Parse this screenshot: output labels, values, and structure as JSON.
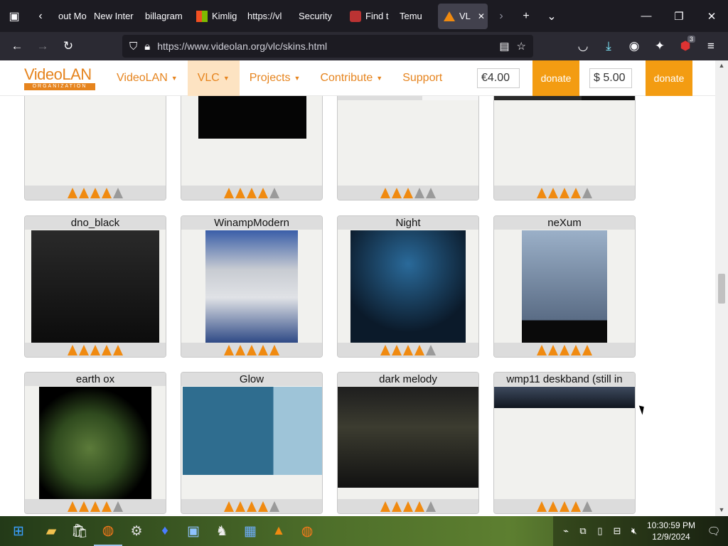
{
  "tabs": [
    {
      "label": "out Mo",
      "icon": "page-icon"
    },
    {
      "label": "New Inter",
      "icon": "page-icon"
    },
    {
      "label": "billagram",
      "icon": "page-icon"
    },
    {
      "label": "Kimlig",
      "icon": "windows-logo-icon"
    },
    {
      "label": "https://vl",
      "icon": "page-icon"
    },
    {
      "label": "Security",
      "icon": "page-icon"
    },
    {
      "label": "Find t",
      "icon": "shield-icon"
    },
    {
      "label": "Temu",
      "icon": "page-icon"
    },
    {
      "label": "VL",
      "icon": "vlc-cone-icon",
      "active": true
    }
  ],
  "address": {
    "url": "https://www.videolan.org/vlc/skins.html"
  },
  "extensions_badge": "3",
  "site": {
    "logo_main": "VideoLAN",
    "logo_sub": "ORGANIZATION",
    "menu": [
      {
        "label": "VideoLAN",
        "dropdown": true
      },
      {
        "label": "VLC",
        "dropdown": true,
        "active": true
      },
      {
        "label": "Projects",
        "dropdown": true
      },
      {
        "label": "Contribute",
        "dropdown": true
      },
      {
        "label": "Support",
        "dropdown": false
      }
    ],
    "donate_eur_value": "€4.00",
    "donate_usd_value": "$ 5.00",
    "donate_label": "donate",
    "accent": "#e6841e",
    "donate_color": "#f39c12"
  },
  "skins": [
    {
      "title": "",
      "rating": 4
    },
    {
      "title": "",
      "rating": 4
    },
    {
      "title": "",
      "rating": 3
    },
    {
      "title": "",
      "rating": 4
    },
    {
      "title": "dno_black",
      "rating": 5
    },
    {
      "title": "WinampModern",
      "rating": 5
    },
    {
      "title": "Night",
      "rating": 4
    },
    {
      "title": "neXum",
      "rating": 5
    },
    {
      "title": "earth ox",
      "rating": 4
    },
    {
      "title": "Glow",
      "rating": 4
    },
    {
      "title": "dark melody",
      "rating": 4
    },
    {
      "title": "wmp11 deskband (still in",
      "rating": 4
    }
  ],
  "taskbar": {
    "apps": [
      "windows-start-icon",
      "file-explorer-icon",
      "store-icon",
      "firefox-icon",
      "settings-gear-icon",
      "blue-flame-icon",
      "image-viewer-icon",
      "chess-icon",
      "news-icon",
      "vlc-cone-icon",
      "firefox-icon"
    ],
    "time": "10:30:59 PM",
    "date": "12/9/2024"
  }
}
